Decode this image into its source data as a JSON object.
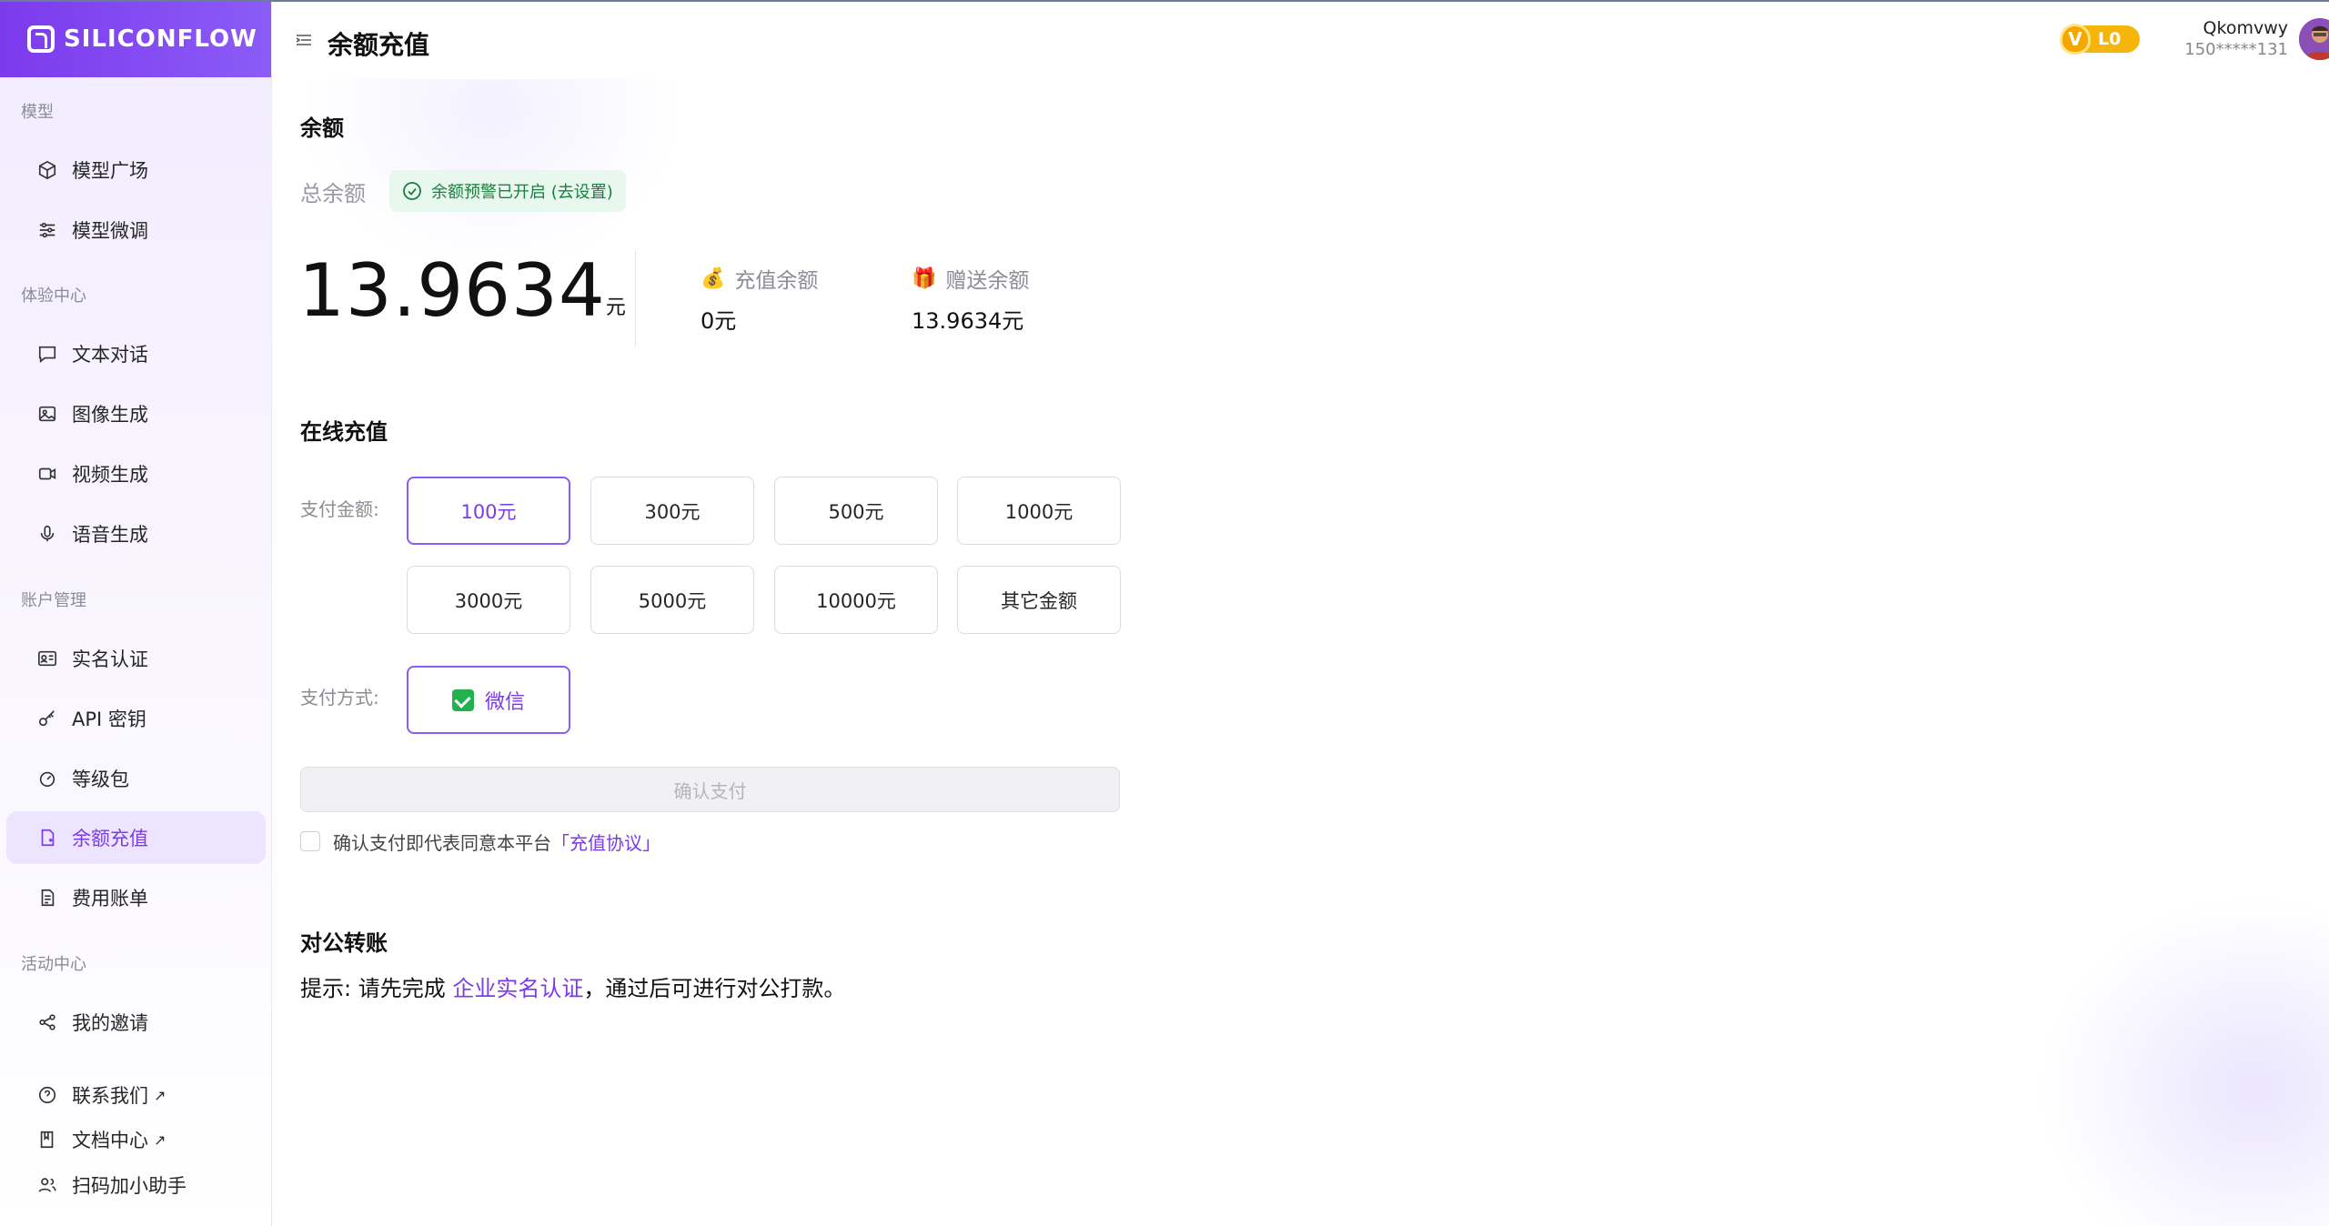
{
  "brand": {
    "name": "SILICONFLOW",
    "accent": "#7c3aed"
  },
  "header": {
    "title": "余额充值",
    "vip_badge": "V",
    "level": "L0",
    "user_name": "Qkomvwy",
    "user_phone": "150*****131"
  },
  "sidebar": {
    "groups": [
      {
        "title": "模型",
        "items": [
          {
            "label": "模型广场",
            "icon": "cube-icon"
          },
          {
            "label": "模型微调",
            "icon": "sliders-icon"
          }
        ]
      },
      {
        "title": "体验中心",
        "items": [
          {
            "label": "文本对话",
            "icon": "chat-icon"
          },
          {
            "label": "图像生成",
            "icon": "image-icon"
          },
          {
            "label": "视频生成",
            "icon": "video-icon"
          },
          {
            "label": "语音生成",
            "icon": "mic-icon"
          }
        ]
      },
      {
        "title": "账户管理",
        "items": [
          {
            "label": "实名认证",
            "icon": "id-card-icon"
          },
          {
            "label": "API 密钥",
            "icon": "key-icon"
          },
          {
            "label": "等级包",
            "icon": "gauge-icon"
          },
          {
            "label": "余额充值",
            "icon": "wallet-icon",
            "active": true
          },
          {
            "label": "费用账单",
            "icon": "bill-icon"
          }
        ]
      },
      {
        "title": "活动中心",
        "items": [
          {
            "label": "我的邀请",
            "icon": "share-icon"
          }
        ]
      }
    ],
    "footer": [
      {
        "label": "联系我们",
        "ext": "↗"
      },
      {
        "label": "文档中心",
        "ext": "↗"
      },
      {
        "label": "扫码加小助手"
      }
    ]
  },
  "balance": {
    "section_title": "余额",
    "total_label": "总余额",
    "alert_tag": "余额预警已开启 (去设置)",
    "total_value": "13.9634",
    "unit": "元",
    "recharge_label": "充值余额",
    "recharge_value": "0元",
    "gift_label": "赠送余额",
    "gift_value": "13.9634元"
  },
  "recharge": {
    "section_title": "在线充值",
    "amount_label": "支付金额:",
    "amounts": [
      "100元",
      "300元",
      "500元",
      "1000元",
      "3000元",
      "5000元",
      "10000元",
      "其它金额"
    ],
    "method_label": "支付方式:",
    "method": "微信",
    "confirm_label": "确认支付",
    "agree_text": "确认支付即代表同意本平台",
    "agree_link": "「充值协议」"
  },
  "transfer": {
    "section_title": "对公转账",
    "tip_prefix": "提示: 请先完成 ",
    "tip_link": "企业实名认证",
    "tip_suffix": "，通过后可进行对公打款。"
  }
}
